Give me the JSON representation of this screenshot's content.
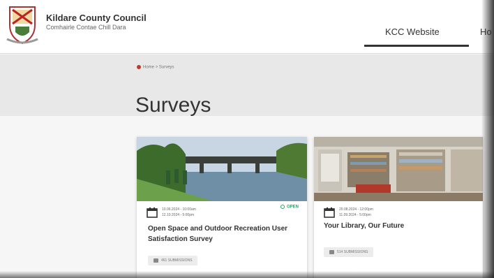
{
  "header": {
    "org_name": "Kildare County Council",
    "org_sub": "Comhairle Contae Chill Dara",
    "nav": [
      "KCC Website",
      "Ho"
    ]
  },
  "breadcrumb": {
    "home": "Home",
    "sep": ">",
    "current": "Surveys"
  },
  "page": {
    "title": "Surveys"
  },
  "cards": [
    {
      "date_start": "10.06.2024 - 10:00am",
      "date_end": "12.10.2024 - 5:00pm",
      "status": "OPEN",
      "title": "Open Space and Outdoor Recreation User Satisfaction Survey",
      "submissions": "461 SUBMISSIONS"
    },
    {
      "date_start": "20.08.2024 - 12:00pm",
      "date_end": "11.09.2024 - 5:00pm",
      "title": "Your Library, Our Future",
      "submissions": "514 SUBMISSIONS"
    }
  ],
  "colors": {
    "accent": "#c0392b",
    "open": "#2e9e6a"
  }
}
